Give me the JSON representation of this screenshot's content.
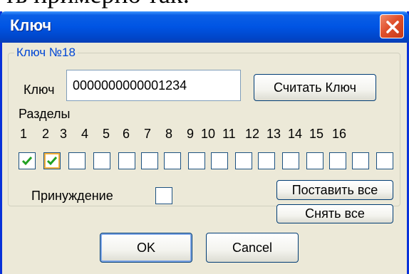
{
  "background_text": "ть примерно так:",
  "window": {
    "title": "Ключ"
  },
  "group": {
    "label": "Ключ №18"
  },
  "key_field": {
    "label": "Ключ",
    "value": "0000000000001234"
  },
  "buttons": {
    "read_key": "Считать Ключ",
    "set_all": "Поставить все",
    "clear_all": "Снять все",
    "ok": "OK",
    "cancel": "Cancel"
  },
  "sections": {
    "label": "Разделы",
    "numbers": [
      "1",
      "2",
      "3",
      "4",
      "5",
      "6",
      "7",
      "8",
      "9",
      "10",
      "11",
      "12",
      "13",
      "14",
      "15",
      "16"
    ],
    "checked": [
      true,
      true,
      false,
      false,
      false,
      false,
      false,
      false,
      false,
      false,
      false,
      false,
      false,
      false,
      false,
      false
    ]
  },
  "coercion": {
    "label": "Принуждение",
    "checked": false
  },
  "colors": {
    "title_bar": "#0054e3",
    "window_bg": "#ece9d8",
    "group_label": "#0046d5",
    "check_green": "#21a121"
  },
  "icons": {
    "close": "close-icon",
    "check": "checkmark-icon"
  }
}
